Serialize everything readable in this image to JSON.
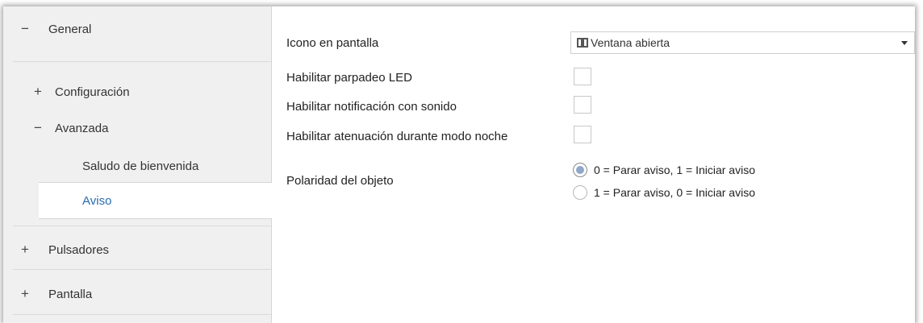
{
  "sidebar": {
    "general": {
      "label": "General",
      "symbol": "−"
    },
    "configuracion": {
      "label": "Configuración",
      "symbol": "+"
    },
    "avanzada": {
      "label": "Avanzada",
      "symbol": "−"
    },
    "saludo": {
      "label": "Saludo de bienvenida"
    },
    "aviso": {
      "label": "Aviso"
    },
    "pulsadores": {
      "label": "Pulsadores",
      "symbol": "+"
    },
    "pantalla": {
      "label": "Pantalla",
      "symbol": "+"
    }
  },
  "main": {
    "icono": {
      "label": "Icono en pantalla",
      "value": "Ventana abierta",
      "icon": "window-icon"
    },
    "parpadeo": {
      "label": "Habilitar parpadeo LED",
      "checked": false
    },
    "sonido": {
      "label": "Habilitar notificación con sonido",
      "checked": false
    },
    "atenuacion": {
      "label": "Habilitar atenuación durante modo noche",
      "checked": false
    },
    "polaridad": {
      "label": "Polaridad del objeto",
      "options": [
        {
          "label": "0 = Parar aviso, 1 = Iniciar aviso",
          "selected": true
        },
        {
          "label": "1 = Parar aviso, 0 = Iniciar aviso",
          "selected": false
        }
      ]
    }
  },
  "colors": {
    "active_nav_text": "#2b6cb0",
    "sidebar_bg": "#f0f0f0",
    "radio_fill": "#8fa8c9"
  }
}
